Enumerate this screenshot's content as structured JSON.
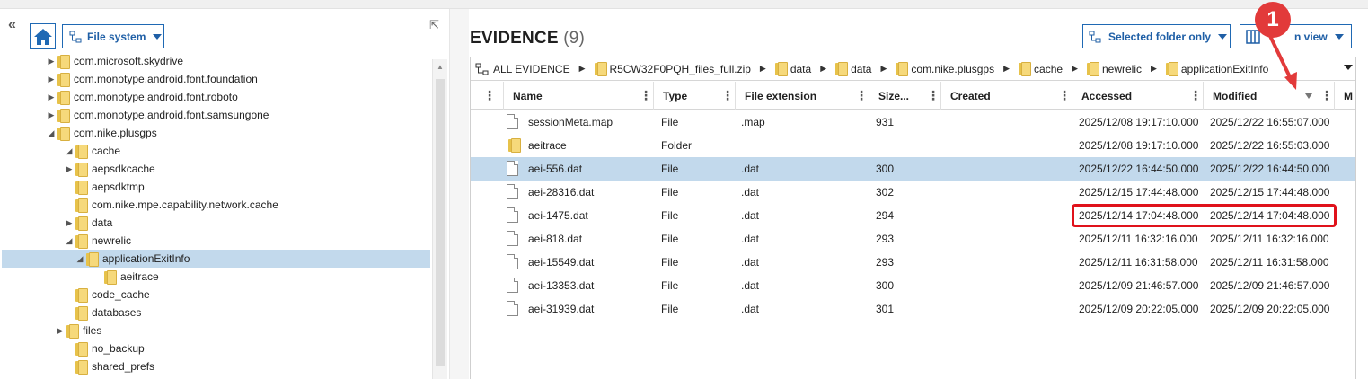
{
  "left_panel": {
    "filesystem_dropdown": "File system",
    "tree": [
      {
        "label": "com.microsoft.skydrive",
        "arrow": "▶"
      },
      {
        "label": "com.monotype.android.font.foundation",
        "arrow": "▶"
      },
      {
        "label": "com.monotype.android.font.roboto",
        "arrow": "▶"
      },
      {
        "label": "com.monotype.android.font.samsungone",
        "arrow": "▶"
      },
      {
        "label": "com.nike.plusgps",
        "arrow": "◢"
      },
      {
        "label": "cache",
        "arrow": "◢"
      },
      {
        "label": "aepsdkcache",
        "arrow": "▶"
      },
      {
        "label": "aepsdktmp",
        "arrow": ""
      },
      {
        "label": "com.nike.mpe.capability.network.cache",
        "arrow": ""
      },
      {
        "label": "data",
        "arrow": "▶"
      },
      {
        "label": "newrelic",
        "arrow": "◢"
      },
      {
        "label": "applicationExitInfo",
        "arrow": "◢",
        "selected": true
      },
      {
        "label": "aeitrace",
        "arrow": ""
      },
      {
        "label": "code_cache",
        "arrow": ""
      },
      {
        "label": "databases",
        "arrow": ""
      },
      {
        "label": "files",
        "arrow": "▶"
      },
      {
        "label": "no_backup",
        "arrow": ""
      },
      {
        "label": "shared_prefs",
        "arrow": ""
      }
    ]
  },
  "main": {
    "title": "EVIDENCE",
    "count": "(9)",
    "selected_folder_dropdown": "Selected folder only",
    "view_dropdown": "n view",
    "breadcrumb": [
      "ALL EVIDENCE",
      "R5CW32F0PQH_files_full.zip",
      "data",
      "data",
      "com.nike.plusgps",
      "cache",
      "newrelic",
      "applicationExitInfo"
    ],
    "columns": [
      "Name",
      "Type",
      "File extension",
      "Size...",
      "Created",
      "Accessed",
      "Modified",
      "M"
    ],
    "rows": [
      {
        "name": "sessionMeta.map",
        "type": "File",
        "ext": ".map",
        "size": "931",
        "created": "",
        "accessed": "2025/12/08 19:17:10.000",
        "modified": "2025/12/22 16:55:07.000",
        "icon": "file-icon"
      },
      {
        "name": "aeitrace",
        "type": "Folder",
        "ext": "",
        "size": "",
        "created": "",
        "accessed": "2025/12/08 19:17:10.000",
        "modified": "2025/12/22 16:55:03.000",
        "icon": "folder-icon"
      },
      {
        "name": "aei-556.dat",
        "type": "File",
        "ext": ".dat",
        "size": "300",
        "created": "",
        "accessed": "2025/12/22 16:44:50.000",
        "modified": "2025/12/22 16:44:50.000",
        "icon": "file-icon",
        "selected": true
      },
      {
        "name": "aei-28316.dat",
        "type": "File",
        "ext": ".dat",
        "size": "302",
        "created": "",
        "accessed": "2025/12/15 17:44:48.000",
        "modified": "2025/12/15 17:44:48.000",
        "icon": "file-icon"
      },
      {
        "name": "aei-1475.dat",
        "type": "File",
        "ext": ".dat",
        "size": "294",
        "created": "",
        "accessed": "2025/12/14 17:04:48.000",
        "modified": "2025/12/14 17:04:48.000",
        "icon": "file-icon"
      },
      {
        "name": "aei-818.dat",
        "type": "File",
        "ext": ".dat",
        "size": "293",
        "created": "",
        "accessed": "2025/12/11 16:32:16.000",
        "modified": "2025/12/11 16:32:16.000",
        "icon": "file-icon"
      },
      {
        "name": "aei-15549.dat",
        "type": "File",
        "ext": ".dat",
        "size": "293",
        "created": "",
        "accessed": "2025/12/11 16:31:58.000",
        "modified": "2025/12/11 16:31:58.000",
        "icon": "file-icon"
      },
      {
        "name": "aei-13353.dat",
        "type": "File",
        "ext": ".dat",
        "size": "300",
        "created": "",
        "accessed": "2025/12/09 21:46:57.000",
        "modified": "2025/12/09 21:46:57.000",
        "icon": "file-icon"
      },
      {
        "name": "aei-31939.dat",
        "type": "File",
        "ext": ".dat",
        "size": "301",
        "created": "",
        "accessed": "2025/12/09 20:22:05.000",
        "modified": "2025/12/09 20:22:05.000",
        "icon": "file-icon"
      }
    ]
  },
  "annotation": {
    "badge": "1",
    "color": "#e23a3a"
  },
  "colors": {
    "accent": "#1f69b4",
    "selection": "#c2d9ec",
    "highlight": "#e0121b"
  }
}
